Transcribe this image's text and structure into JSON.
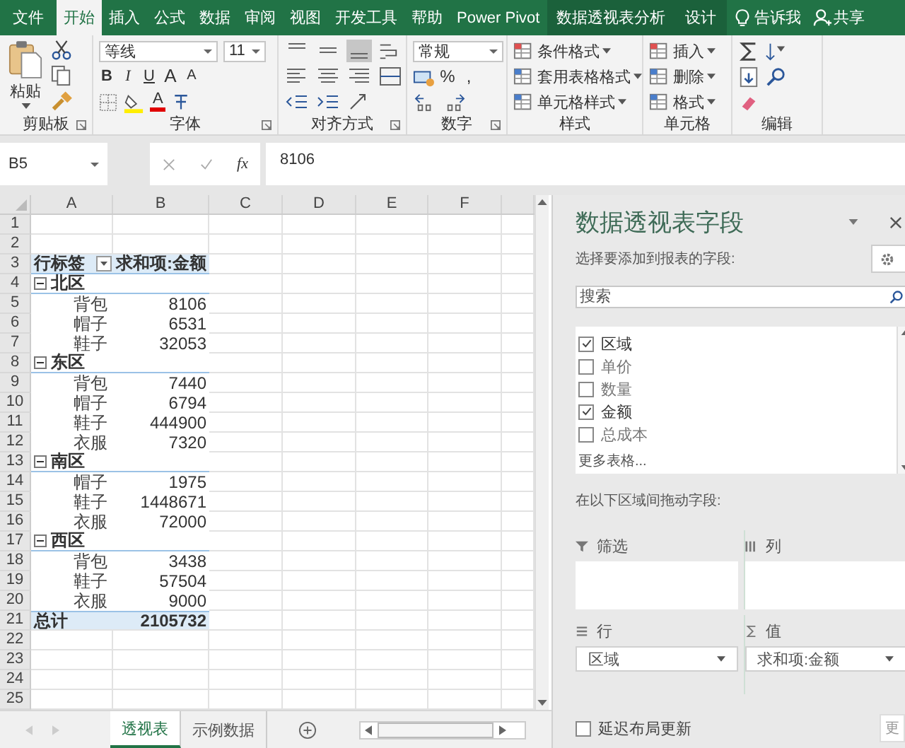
{
  "ribbon_tabs": [
    {
      "label": "文件",
      "selected": false,
      "contextual": false
    },
    {
      "label": "开始",
      "selected": true,
      "contextual": false
    },
    {
      "label": "插入",
      "selected": false,
      "contextual": false
    },
    {
      "label": "公式",
      "selected": false,
      "contextual": false
    },
    {
      "label": "数据",
      "selected": false,
      "contextual": false
    },
    {
      "label": "审阅",
      "selected": false,
      "contextual": false
    },
    {
      "label": "视图",
      "selected": false,
      "contextual": false
    },
    {
      "label": "开发工具",
      "selected": false,
      "contextual": false
    },
    {
      "label": "帮助",
      "selected": false,
      "contextual": false
    },
    {
      "label": "Power Pivot",
      "selected": false,
      "contextual": false
    },
    {
      "label": "数据透视表分析",
      "selected": false,
      "contextual": true
    },
    {
      "label": "设计",
      "selected": false,
      "contextual": true
    }
  ],
  "tell_me": "告诉我",
  "share": "共享",
  "ribbon_groups": [
    {
      "kind": "clipboard",
      "label": "剪贴板",
      "launcher": true,
      "paste": "粘贴"
    },
    {
      "kind": "font",
      "label": "字体",
      "launcher": true,
      "font_name": "等线",
      "font_size": "11",
      "format_buttons": [
        "B",
        "I",
        "U"
      ],
      "size_buttons": [
        "A",
        "A"
      ],
      "font_color": "A"
    },
    {
      "kind": "alignment",
      "label": "对齐方式",
      "launcher": true,
      "vertical_align": [
        {
          "selected": false
        },
        {
          "selected": false
        },
        {
          "selected": true
        }
      ]
    },
    {
      "kind": "number",
      "label": "数字",
      "launcher": true,
      "format": "常规",
      "symbols": [
        "%",
        ","
      ]
    },
    {
      "kind": "styles",
      "label": "样式",
      "launcher": false,
      "buttons": [
        "条件格式",
        "套用表格格式",
        "单元格样式"
      ]
    },
    {
      "kind": "cells",
      "label": "单元格",
      "launcher": false,
      "buttons": [
        "插入",
        "删除",
        "格式"
      ]
    },
    {
      "kind": "editing",
      "label": "编辑",
      "launcher": false
    }
  ],
  "formula_bar": {
    "name_box": "B5",
    "fx": "fx",
    "formula": "8106"
  },
  "columns": [
    "A",
    "B",
    "C",
    "D",
    "E",
    "F"
  ],
  "rows": [
    {
      "number": "1",
      "kind": "blank"
    },
    {
      "number": "2",
      "kind": "blank"
    },
    {
      "number": "3",
      "kind": "header",
      "label": "行标签",
      "value": "求和项:金额"
    },
    {
      "number": "4",
      "kind": "group",
      "label": "北区",
      "expanded": true
    },
    {
      "number": "5",
      "kind": "item",
      "label": "背包",
      "value": "8106"
    },
    {
      "number": "6",
      "kind": "item",
      "label": "帽子",
      "value": "6531"
    },
    {
      "number": "7",
      "kind": "item",
      "label": "鞋子",
      "value": "32053"
    },
    {
      "number": "8",
      "kind": "group",
      "label": "东区",
      "expanded": true
    },
    {
      "number": "9",
      "kind": "item",
      "label": "背包",
      "value": "7440"
    },
    {
      "number": "10",
      "kind": "item",
      "label": "帽子",
      "value": "6794"
    },
    {
      "number": "11",
      "kind": "item",
      "label": "鞋子",
      "value": "444900"
    },
    {
      "number": "12",
      "kind": "item",
      "label": "衣服",
      "value": "7320"
    },
    {
      "number": "13",
      "kind": "group",
      "label": "南区",
      "expanded": true
    },
    {
      "number": "14",
      "kind": "item",
      "label": "帽子",
      "value": "1975"
    },
    {
      "number": "15",
      "kind": "item",
      "label": "鞋子",
      "value": "1448671"
    },
    {
      "number": "16",
      "kind": "item",
      "label": "衣服",
      "value": "72000"
    },
    {
      "number": "17",
      "kind": "group",
      "label": "西区",
      "expanded": true
    },
    {
      "number": "18",
      "kind": "item",
      "label": "背包",
      "value": "3438"
    },
    {
      "number": "19",
      "kind": "item",
      "label": "鞋子",
      "value": "57504"
    },
    {
      "number": "20",
      "kind": "item",
      "label": "衣服",
      "value": "9000"
    },
    {
      "number": "21",
      "kind": "total",
      "label": "总计",
      "value": "2105732"
    },
    {
      "number": "22",
      "kind": "blank"
    },
    {
      "number": "23",
      "kind": "blank"
    },
    {
      "number": "24",
      "kind": "blank"
    },
    {
      "number": "25",
      "kind": "blank"
    }
  ],
  "sheet_tabs": [
    {
      "label": "透视表",
      "selected": true
    },
    {
      "label": "示例数据",
      "selected": false
    }
  ],
  "pivot_pane": {
    "title": "数据透视表字段",
    "subtitle": "选择要添加到报表的字段:",
    "search": {
      "placeholder": "搜索"
    },
    "fields": [
      {
        "label": "区域",
        "checked": true
      },
      {
        "label": "单价",
        "checked": false
      },
      {
        "label": "数量",
        "checked": false
      },
      {
        "label": "金额",
        "checked": true
      },
      {
        "label": "总成本",
        "checked": false
      }
    ],
    "more_tables": "更多表格...",
    "drag_hint": "在以下区域间拖动字段:",
    "areas": [
      {
        "kind": "filter",
        "label": "筛选"
      },
      {
        "kind": "columns",
        "label": "列"
      },
      {
        "kind": "rows",
        "label": "行",
        "items": [
          "区域"
        ]
      },
      {
        "kind": "values",
        "label": "值",
        "items": [
          "求和项:金额"
        ]
      }
    ],
    "defer_update": {
      "label": "延迟布局更新",
      "checked": false
    },
    "update_button": "更"
  }
}
